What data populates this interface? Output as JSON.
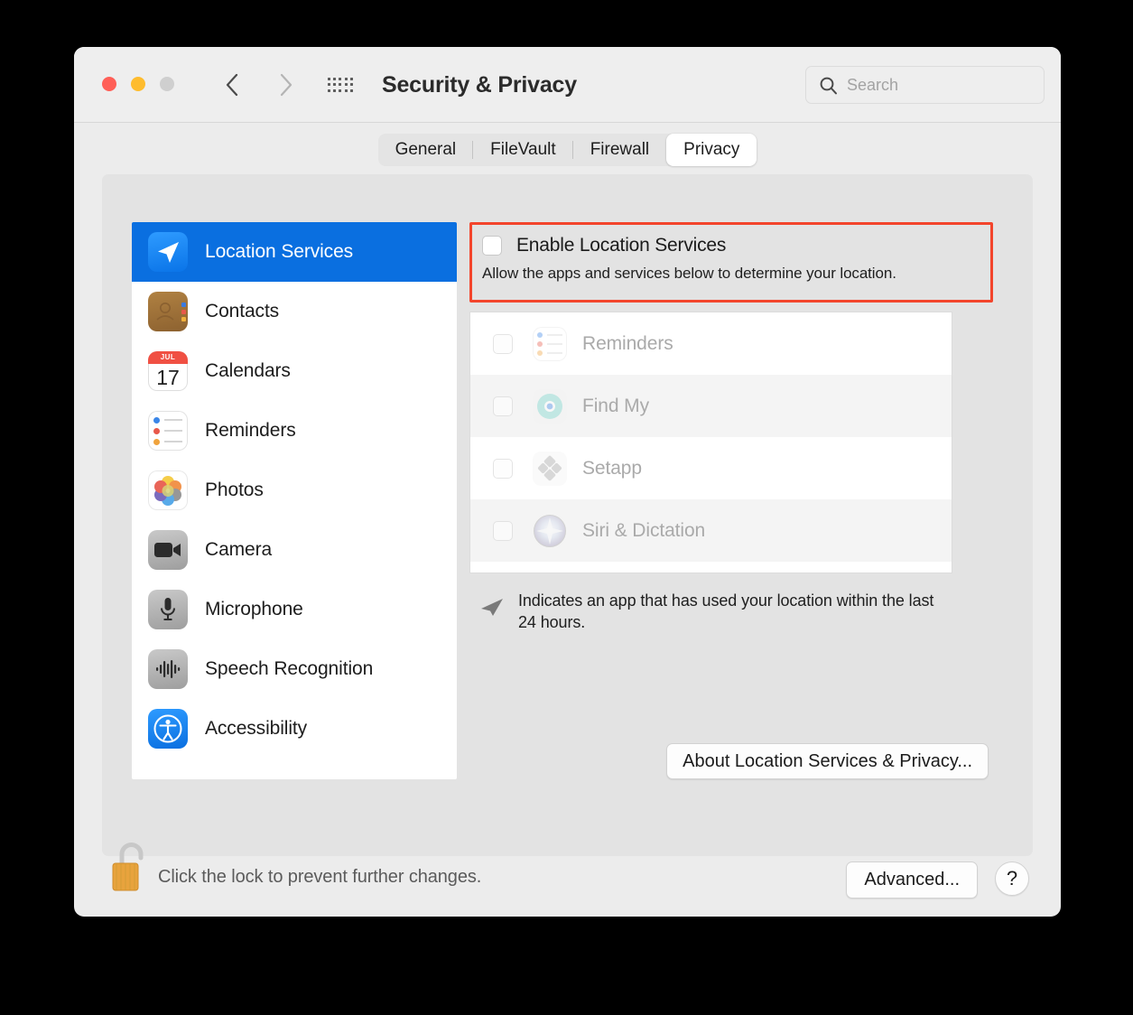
{
  "window": {
    "title": "Security & Privacy",
    "traffic_lights": {
      "close": "close-button",
      "minimize": "minimize-button",
      "maximize": "maximize-button"
    },
    "colors": {
      "accent_blue": "#0a6fe0",
      "highlight_red": "#f3452c",
      "close_red": "#ff5f57",
      "minimize_yellow": "#febc2e",
      "maximize_grey": "#cfcfcf",
      "window_bg": "#ececec",
      "panel_bg": "#e3e3e3"
    }
  },
  "search": {
    "placeholder": "Search",
    "value": ""
  },
  "tabs": [
    {
      "label": "General",
      "active": false
    },
    {
      "label": "FileVault",
      "active": false
    },
    {
      "label": "Firewall",
      "active": false
    },
    {
      "label": "Privacy",
      "active": true
    }
  ],
  "sidebar": {
    "items": [
      {
        "label": "Location Services",
        "icon": "location-arrow-icon",
        "selected": true
      },
      {
        "label": "Contacts",
        "icon": "contacts-icon",
        "selected": false
      },
      {
        "label": "Calendars",
        "icon": "calendar-icon",
        "selected": false
      },
      {
        "label": "Reminders",
        "icon": "reminders-icon",
        "selected": false
      },
      {
        "label": "Photos",
        "icon": "photos-icon",
        "selected": false
      },
      {
        "label": "Camera",
        "icon": "camera-icon",
        "selected": false
      },
      {
        "label": "Microphone",
        "icon": "microphone-icon",
        "selected": false
      },
      {
        "label": "Speech Recognition",
        "icon": "speech-recognition-icon",
        "selected": false
      },
      {
        "label": "Accessibility",
        "icon": "accessibility-icon",
        "selected": false
      }
    ]
  },
  "calendar_icon": {
    "month": "JUL",
    "day": "17"
  },
  "main": {
    "enable": {
      "label": "Enable Location Services",
      "checked": false,
      "description": "Allow the apps and services below to determine your location."
    },
    "apps": [
      {
        "label": "Reminders",
        "checked": false,
        "icon": "reminders-icon"
      },
      {
        "label": "Find My",
        "checked": false,
        "icon": "find-my-icon"
      },
      {
        "label": "Setapp",
        "checked": false,
        "icon": "setapp-icon"
      },
      {
        "label": "Siri & Dictation",
        "checked": false,
        "icon": "siri-icon"
      }
    ],
    "note": "Indicates an app that has used your location within the last 24 hours.",
    "about_button": "About Location Services & Privacy..."
  },
  "bottom": {
    "lock_text": "Click the lock to prevent further changes.",
    "lock_state": "unlocked",
    "advanced_button": "Advanced...",
    "help_button": "?"
  }
}
